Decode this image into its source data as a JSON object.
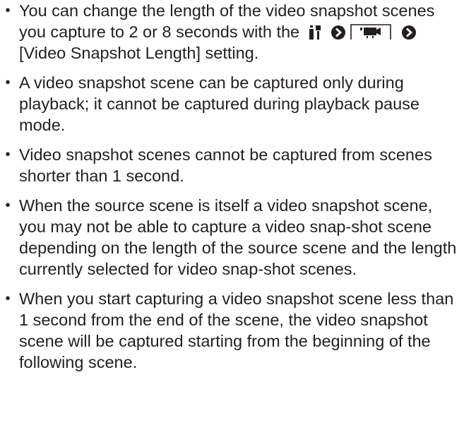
{
  "notes": [
    {
      "part1": "You can change the length of the video snapshot scenes you capture to 2 or 8 seconds with the",
      "part2": "[Video Snapshot Length] setting."
    },
    {
      "text": "A video snapshot scene can be captured only during playback; it cannot be captured during playback pause mode."
    },
    {
      "text": "Video snapshot scenes cannot be captured from scenes shorter than 1 second."
    },
    {
      "text": "When the source scene is itself a video snapshot scene, you may not be able to capture a video snap-shot scene depending on the length of the source scene and the length currently selected for video snap-shot scenes."
    },
    {
      "text": "When you start capturing a video snapshot scene less than 1 second from the end of the scene, the video snapshot scene will be captured starting from the beginning of the following scene."
    }
  ],
  "bullet": "•",
  "icons": {
    "menu": "tools-menu-icon",
    "arrow": "chevron-right-circle-icon",
    "tab": "video-playback-menu-tab-icon"
  }
}
